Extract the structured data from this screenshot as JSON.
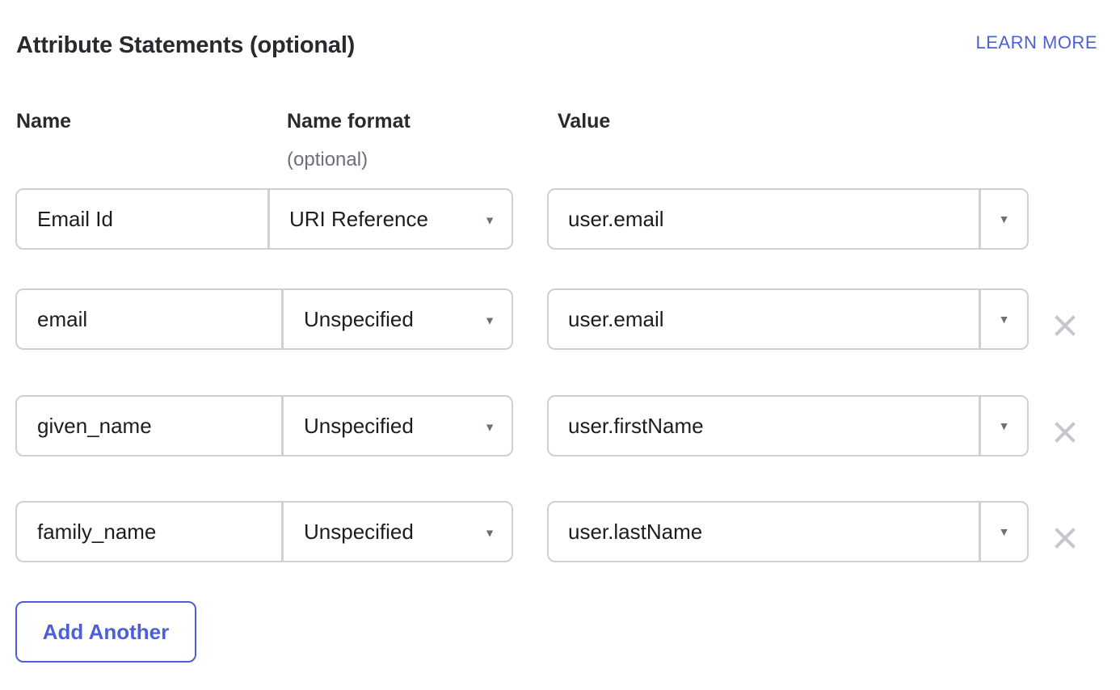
{
  "section": {
    "title": "Attribute Statements (optional)",
    "learn_more": "LEARN MORE"
  },
  "columns": {
    "name": "Name",
    "name_format": "Name format",
    "name_format_sub": "(optional)",
    "value": "Value"
  },
  "rows": [
    {
      "name": "Email Id",
      "name_format": "URI Reference",
      "value": "user.email",
      "removable": false
    },
    {
      "name": "email",
      "name_format": "Unspecified",
      "value": "user.email",
      "removable": true
    },
    {
      "name": "given_name",
      "name_format": "Unspecified",
      "value": "user.firstName",
      "removable": true
    },
    {
      "name": "family_name",
      "name_format": "Unspecified",
      "value": "user.lastName",
      "removable": true
    }
  ],
  "icons": {
    "dropdown": "caret-down-icon",
    "remove": "close-icon"
  },
  "add_button": "Add Another",
  "colors": {
    "accent": "#4d5fd6",
    "border": "#d0d0d4",
    "remove_icon": "#c6c6cc"
  }
}
